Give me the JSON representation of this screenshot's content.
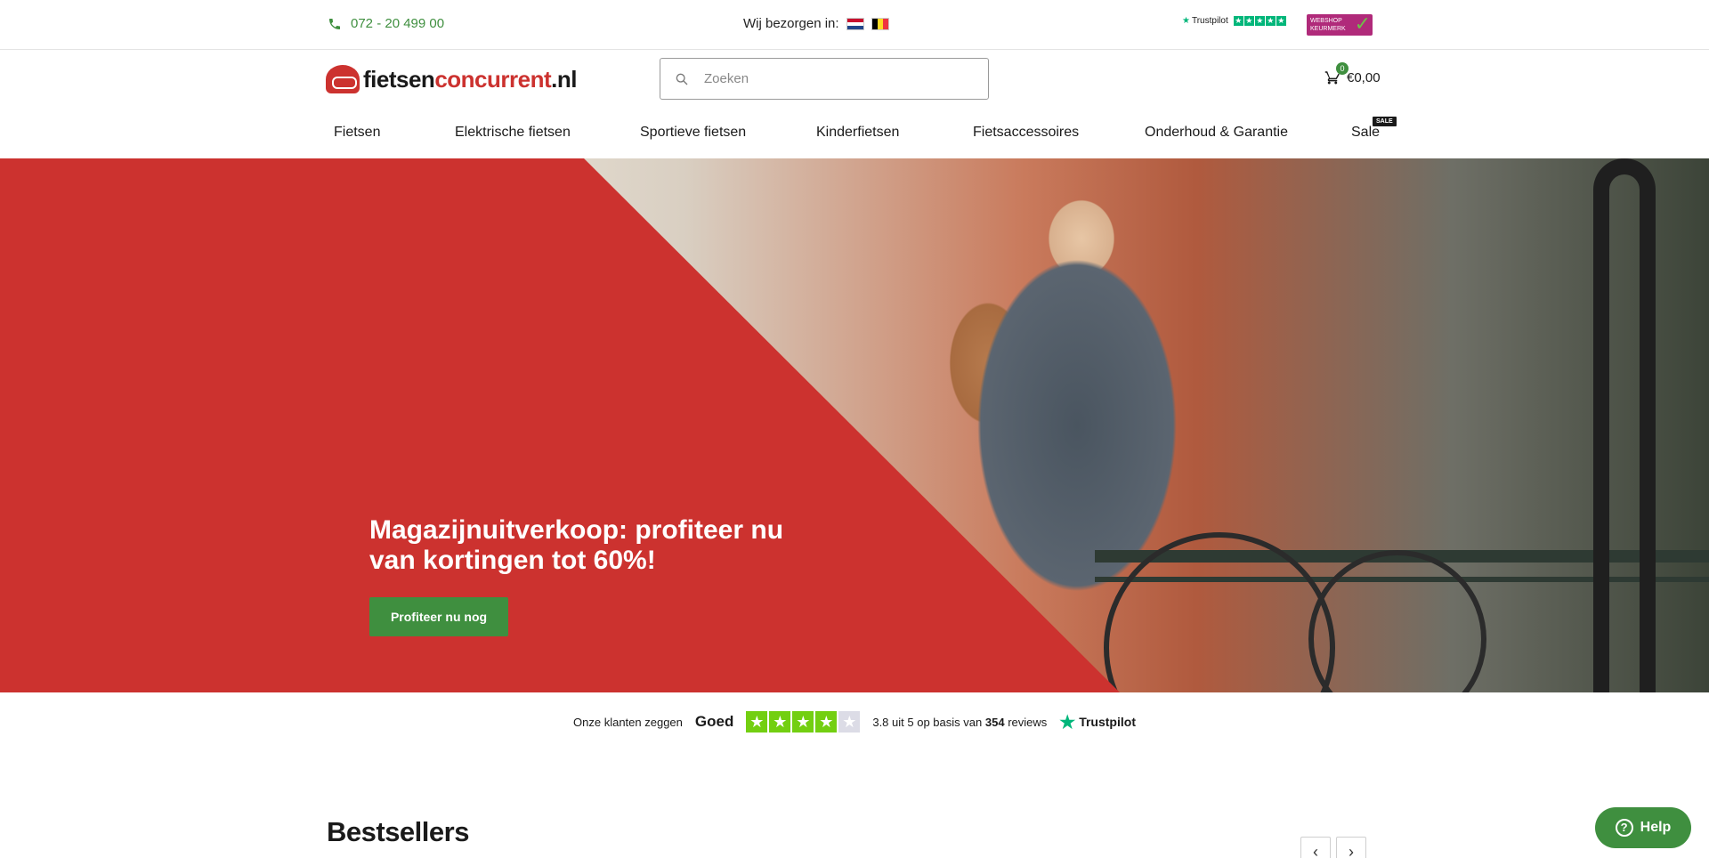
{
  "topbar": {
    "phone": "072 - 20 499 00",
    "deliver_label": "Wij bezorgen in:",
    "trustpilot_label": "Trustpilot",
    "keurmerk_label": "WEBSHOP KEURMERK"
  },
  "header": {
    "logo": {
      "part1": "fietsen",
      "part2": "concurrent",
      "part3": ".nl"
    },
    "search_placeholder": "Zoeken",
    "cart_count": "0",
    "cart_total": "€0,00"
  },
  "nav": {
    "items": [
      {
        "label": "Fietsen"
      },
      {
        "label": "Elektrische fietsen"
      },
      {
        "label": "Sportieve fietsen"
      },
      {
        "label": "Kinderfietsen"
      },
      {
        "label": "Fietsaccessoires"
      },
      {
        "label": "Onderhoud & Garantie"
      },
      {
        "label": "Sale"
      }
    ],
    "sale_badge": "SALE"
  },
  "hero": {
    "title": "Magazijnuitverkoop: profiteer nu van kortingen tot 60%!",
    "button": "Profiteer nu nog"
  },
  "trust_strip": {
    "intro": "Onze klanten zeggen",
    "rating_word": "Goed",
    "stars_filled": 4,
    "stars_total": 5,
    "score_prefix": "3.8",
    "score_middle": "uit 5 op basis van",
    "review_count": "354",
    "score_suffix": "reviews",
    "brand": "Trustpilot"
  },
  "section": {
    "title": "Bestsellers"
  },
  "help": {
    "label": "Help"
  },
  "colors": {
    "brand_red": "#cc322f",
    "brand_green": "#3f8f3f",
    "trustpilot_green": "#73cf11"
  }
}
